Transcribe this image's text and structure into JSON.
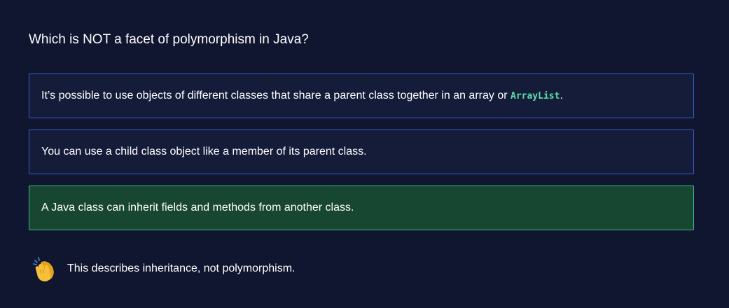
{
  "question": {
    "text": "Which is NOT a facet of polymorphism in Java?"
  },
  "options": [
    {
      "text_before": "It’s possible to use objects of different classes that share a parent class together in an array or ",
      "code": "ArrayList",
      "text_after": ".",
      "state": "default"
    },
    {
      "text": "You can use a child class object like a member of its parent class.",
      "state": "default"
    },
    {
      "text": "A Java class can inherit fields and methods from another class.",
      "state": "correct"
    }
  ],
  "feedback": {
    "icon": "clapping-hands-icon",
    "text": "This describes inheritance, not polymorphism."
  },
  "colors": {
    "background": "#10162f",
    "option_border": "#3a5ccc",
    "correct_background": "#174631",
    "correct_border": "#3fb883",
    "code_text": "#5ce0a8"
  }
}
